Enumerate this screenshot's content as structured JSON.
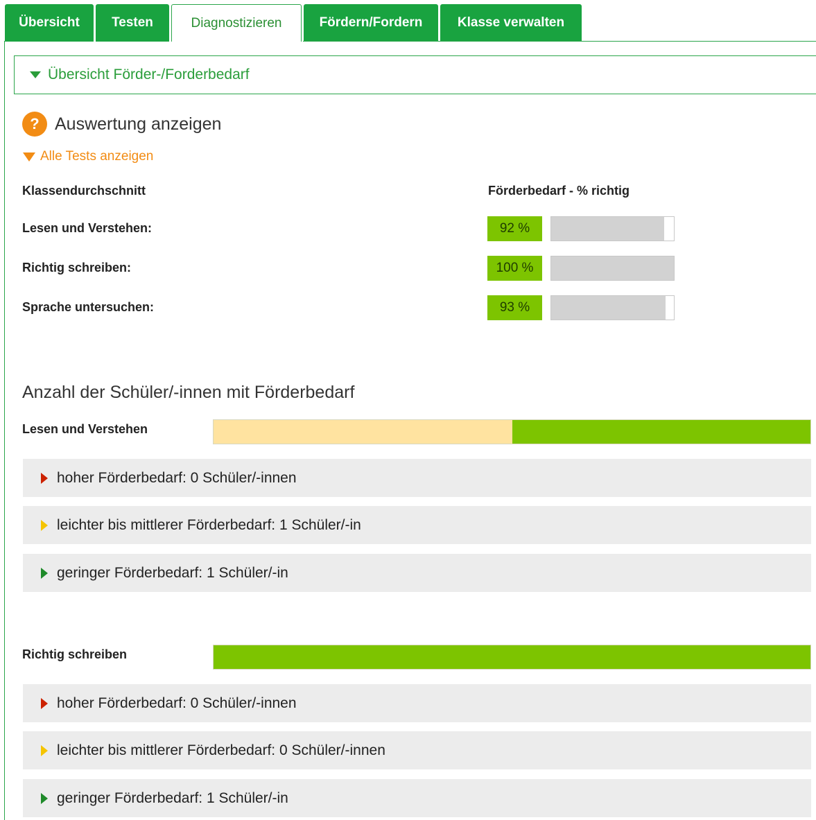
{
  "tabs": [
    {
      "label": "Übersicht",
      "active": false
    },
    {
      "label": "Testen",
      "active": false
    },
    {
      "label": "Diagnostizieren",
      "active": true
    },
    {
      "label": "Fördern/Fordern",
      "active": false
    },
    {
      "label": "Klasse verwalten",
      "active": false
    }
  ],
  "accordion": {
    "title": "Übersicht Förder-/Forderbedarf",
    "icon": "triangle-down-icon"
  },
  "help": {
    "icon": "?",
    "title": "Auswertung anzeigen"
  },
  "all_tests": {
    "label": "Alle Tests anzeigen"
  },
  "average": {
    "header_left": "Klassendurchschnitt",
    "header_right": "Förderbedarf - % richtig",
    "rows": [
      {
        "label": "Lesen und Verstehen:",
        "percent_text": "92 %",
        "percent": 92
      },
      {
        "label": "Richtig schreiben:",
        "percent_text": "100 %",
        "percent": 100
      },
      {
        "label": "Sprache untersuchen:",
        "percent_text": "93 %",
        "percent": 93
      }
    ]
  },
  "students_section": {
    "title": "Anzahl der Schüler/-innen mit Förderbedarf",
    "groups": [
      {
        "label": "Lesen und Verstehen",
        "distribution": {
          "medium": 1,
          "low": 1,
          "high": 0
        },
        "items": [
          {
            "text": "hoher Förderbedarf: 0 Schüler/-innen",
            "color": "#cc2200"
          },
          {
            "text": "leichter bis mittlerer Förderbedarf: 1 Schüler/-in",
            "color": "#f5c400"
          },
          {
            "text": "geringer Förderbedarf: 1 Schüler/-in",
            "color": "#1f8a2a"
          }
        ]
      },
      {
        "label": "Richtig schreiben",
        "distribution": {
          "medium": 0,
          "low": 1,
          "high": 0
        },
        "items": [
          {
            "text": "hoher Förderbedarf: 0 Schüler/-innen",
            "color": "#cc2200"
          },
          {
            "text": "leichter bis mittlerer Förderbedarf: 0 Schüler/-innen",
            "color": "#f5c400"
          },
          {
            "text": "geringer Förderbedarf: 1 Schüler/-in",
            "color": "#1f8a2a"
          }
        ]
      }
    ]
  },
  "colors": {
    "brand_green": "#19a340",
    "bar_green": "#7dc400",
    "bar_yellow": "#ffe3a0",
    "accent_orange": "#f28c14"
  }
}
